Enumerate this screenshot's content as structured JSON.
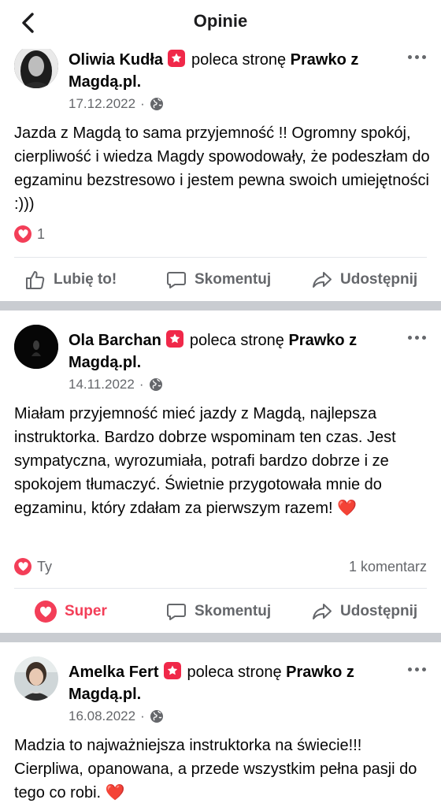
{
  "header": {
    "title": "Opinie"
  },
  "recommends_text": "poleca stronę",
  "page_name_line1": "Prawko z",
  "page_name_line2": "Magdą.pl.",
  "actions": {
    "like": "Lubię to!",
    "super": "Super",
    "comment": "Skomentuj",
    "share": "Udostępnij"
  },
  "posts": [
    {
      "author": "Oliwia Kudła",
      "date": "17.12.2022",
      "text": "Jazda z Magdą to sama przyjemność !! Ogromny spokój, cierpliwość i wiedza Magdy spowodowały, że podeszłam do egzaminu bezstresowo i jestem pewna swoich umiejętności :)))",
      "reaction_count": "1",
      "comments": "",
      "reacted": false,
      "avatar_color": "#2a2a2a"
    },
    {
      "author": "Ola Barchan",
      "date": "14.11.2022",
      "text": "Miałam przyjemność mieć jazdy z Magdą, najlepsza instruktorka. Bardzo dobrze wspominam ten czas. Jest sympatyczna, wyrozumiała, potrafi bardzo dobrze i ze spokojem tłumaczyć. Świetnie przygotowała mnie do egzaminu, który zdałam za pierwszym razem! ❤️",
      "reaction_count": "Ty",
      "comments": "1 komentarz",
      "reacted": true,
      "avatar_color": "#0a0a0a"
    },
    {
      "author": "Amelka Fert",
      "date": "16.08.2022",
      "text": "Madzia to najważniejsza instruktorka na świecie!!! Cierpliwa, opanowana, a przede wszystkim pełna pasji do tego co robi. ❤️",
      "reaction_count": "",
      "comments": "",
      "reacted": false,
      "avatar_color": "#d9d2cb"
    }
  ],
  "colors": {
    "brand_red": "#f02849",
    "secondary_text": "#65676b",
    "divider": "#c9ccd1"
  },
  "icons": [
    "back-arrow-icon",
    "recommend-star-icon",
    "more-dots-icon",
    "globe-icon",
    "heart-reaction-icon",
    "like-thumb-icon",
    "comment-bubble-icon",
    "share-arrow-icon"
  ]
}
